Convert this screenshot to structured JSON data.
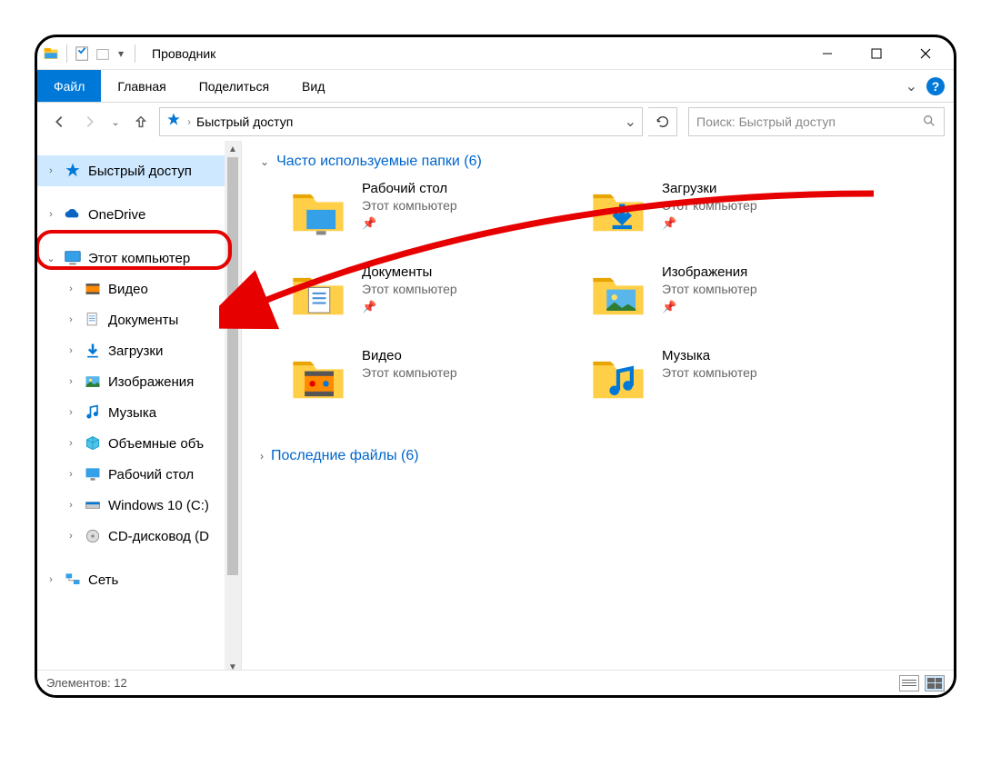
{
  "window": {
    "title": "Проводник"
  },
  "ribbon": {
    "tabs": {
      "file": "Файл",
      "home": "Главная",
      "share": "Поделиться",
      "view": "Вид"
    }
  },
  "address": {
    "location": "Быстрый доступ"
  },
  "search": {
    "placeholder": "Поиск: Быстрый доступ"
  },
  "sidebar": {
    "quick_access": "Быстрый доступ",
    "onedrive": "OneDrive",
    "this_pc": "Этот компьютер",
    "children": {
      "video": "Видео",
      "documents": "Документы",
      "downloads": "Загрузки",
      "pictures": "Изображения",
      "music": "Музыка",
      "volumes": "Объемные объ",
      "desktop": "Рабочий стол",
      "cdrive": "Windows 10 (C:)",
      "cddrive": "CD-дисковод (D"
    },
    "network": "Сеть"
  },
  "content": {
    "frequent_header": "Часто используемые папки (6)",
    "recent_header": "Последние файлы (6)",
    "sub_location": "Этот компьютер",
    "tiles": {
      "desktop": "Рабочий стол",
      "downloads": "Загрузки",
      "documents": "Документы",
      "pictures": "Изображения",
      "video": "Видео",
      "music": "Музыка"
    }
  },
  "status": {
    "text": "Элементов: 12"
  }
}
